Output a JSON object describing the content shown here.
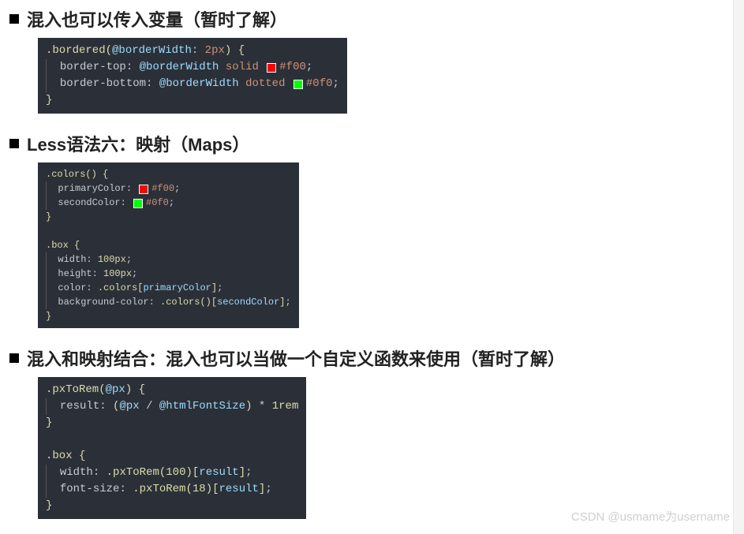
{
  "sections": [
    {
      "title": "混入也可以传入变量（暂时了解）"
    },
    {
      "title": "Less语法六：映射（Maps）"
    },
    {
      "title": "混入和映射结合：混入也可以当做一个自定义函数来使用（暂时了解）"
    }
  ],
  "code1": {
    "l1_sel": ".bordered",
    "l1_paren_open": "(",
    "l1_var": "@borderWidth",
    "l1_colon": ": ",
    "l1_val": "2px",
    "l1_paren_close": ")",
    "l1_brace": " {",
    "l2_prop": "border-top",
    "l2_colon": ": ",
    "l2_var": "@borderWidth",
    "l2_kw": " solid ",
    "l2_hex": "#f00",
    "l2_semi": ";",
    "l3_prop": "border-bottom",
    "l3_colon": ": ",
    "l3_var": "@borderWidth",
    "l3_kw": " dotted ",
    "l3_hex": "#0f0",
    "l3_semi": ";",
    "l4_brace": "}"
  },
  "code2": {
    "a1_sel": ".colors",
    "a1_paren": "()",
    "a1_brace": " {",
    "a2_prop": "primaryColor",
    "a2_colon": ": ",
    "a2_hex": "#f00",
    "a2_semi": ";",
    "a3_prop": "secondColor",
    "a3_colon": ": ",
    "a3_hex": "#0f0",
    "a3_semi": ";",
    "a4_brace": "}",
    "b1_sel": ".box",
    "b1_brace": " {",
    "b2_prop": "width",
    "b2_colon": ": ",
    "b2_val": "100px",
    "b2_semi": ";",
    "b3_prop": "height",
    "b3_colon": ": ",
    "b3_val": "100px",
    "b3_semi": ";",
    "b4_prop": "color",
    "b4_colon": ": ",
    "b4_call": ".colors",
    "b4_br_open": "[",
    "b4_key": "primaryColor",
    "b4_br_close": "]",
    "b4_semi": ";",
    "b5_prop": "background-color",
    "b5_colon": ": ",
    "b5_call": ".colors",
    "b5_paren": "()",
    "b5_br_open": "[",
    "b5_key": "secondColor",
    "b5_br_close": "]",
    "b5_semi": ";",
    "b6_brace": "}"
  },
  "code3": {
    "a1_sel": ".pxToRem",
    "a1_paren_open": "(",
    "a1_var": "@px",
    "a1_paren_close": ")",
    "a1_brace": " {",
    "a2_prop": "result",
    "a2_colon": ": ",
    "a2_expr_open": "(",
    "a2_v1": "@px",
    "a2_div": " / ",
    "a2_v2": "@htmlFontSize",
    "a2_expr_close": ")",
    "a2_mul": " * ",
    "a2_unit": "1rem",
    "a3_brace": "}",
    "b1_sel": ".box",
    "b1_brace": " {",
    "b2_prop": "width",
    "b2_colon": ": ",
    "b2_call": ".pxToRem",
    "b2_paren_open": "(",
    "b2_num": "100",
    "b2_paren_close": ")",
    "b2_br_open": "[",
    "b2_key": "result",
    "b2_br_close": "]",
    "b2_semi": ";",
    "b3_prop": "font-size",
    "b3_colon": ": ",
    "b3_call": ".pxToRem",
    "b3_paren_open": "(",
    "b3_num": "18",
    "b3_paren_close": ")",
    "b3_br_open": "[",
    "b3_key": "result",
    "b3_br_close": "]",
    "b3_semi": ";",
    "b4_brace": "}"
  },
  "watermark": "CSDN @usmame为username"
}
